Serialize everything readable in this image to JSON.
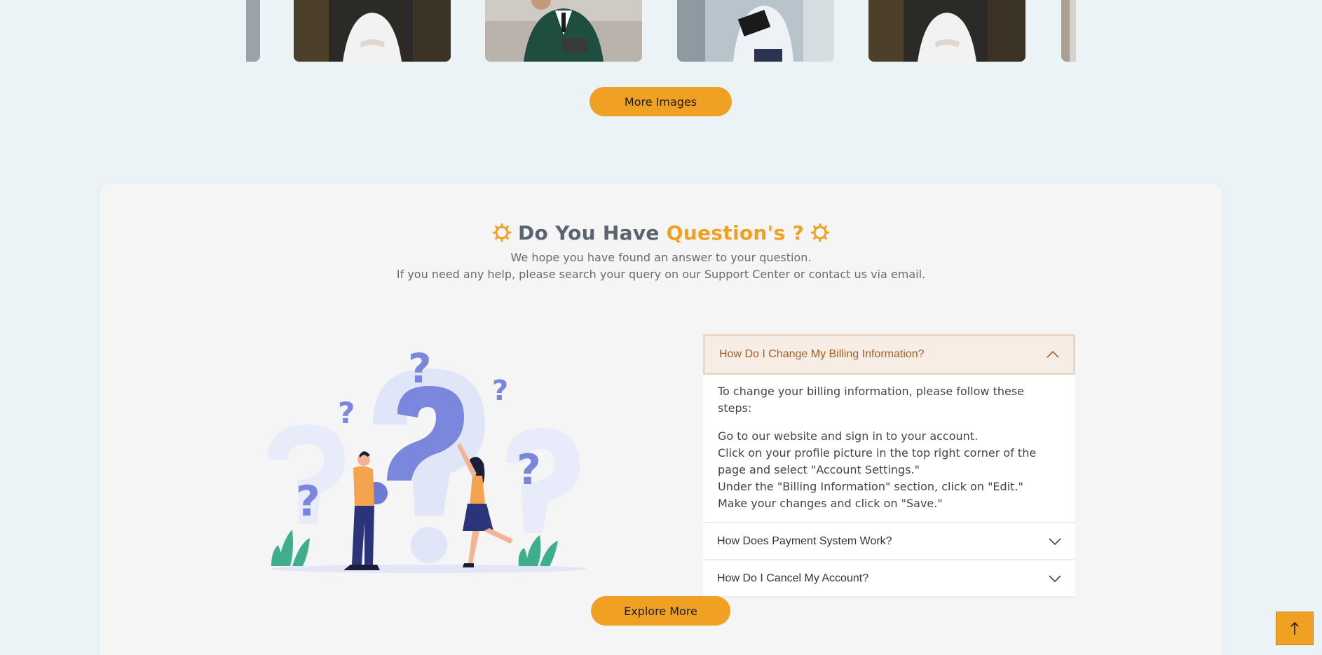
{
  "gallery": {
    "images": [
      {
        "name": "woman-white-shirt-photo"
      },
      {
        "name": "man-green-suit-photo"
      },
      {
        "name": "man-clipboard-photo"
      },
      {
        "name": "woman-white-shirt-photo"
      }
    ],
    "more_button": "More Images"
  },
  "faq": {
    "title_part1": "Do You Have",
    "title_accent": "Question's ?",
    "subtitle_line1": "We hope you have found an answer to your question.",
    "subtitle_line2": "If you need any help, please search your query on our Support Center or contact us via email.",
    "items": [
      {
        "question": "How Do I Change My Billing Information?",
        "open": true,
        "intro": "To change your billing information, please follow these steps:",
        "steps": [
          "Go to our website and sign in to your account.",
          "Click on your profile picture in the top right corner of the page and select \"Account Settings.\"",
          "Under the \"Billing Information\" section, click on \"Edit.\"",
          "Make your changes and click on \"Save.\""
        ]
      },
      {
        "question": "How Does Payment System Work?",
        "open": false
      },
      {
        "question": "How Do I Cancel My Account?",
        "open": false
      }
    ],
    "explore_button": "Explore More"
  },
  "colors": {
    "accent": "#f0a022",
    "page_bg": "#ebf3f6",
    "card_bg": "#f5f5f5"
  },
  "icons": {
    "title_decoration": "gear-icon",
    "accordion_open": "chevron-up-icon",
    "accordion_closed": "chevron-down-icon",
    "scroll_top": "arrow-up-icon"
  }
}
